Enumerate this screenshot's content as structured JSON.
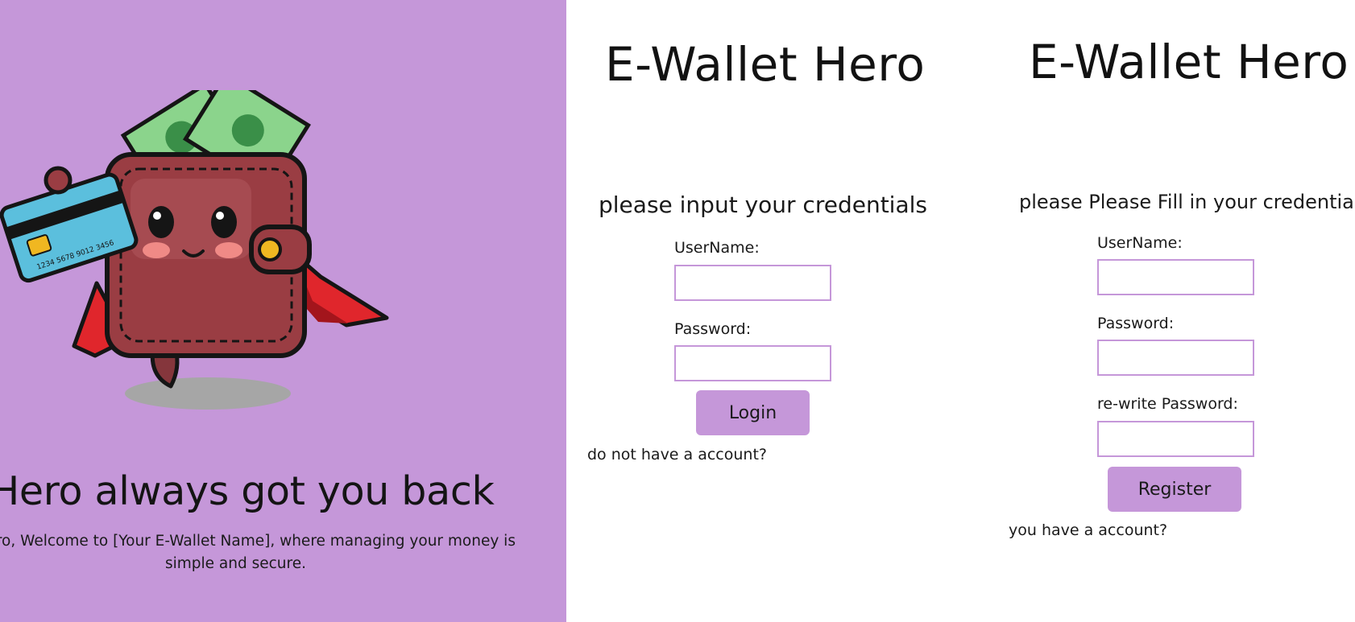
{
  "promo": {
    "headline": "let Hero always got you back",
    "text": "et Hero, Welcome to [Your E-Wallet Name], where managing your money is simple and secure."
  },
  "login": {
    "title": "E-Wallet Hero",
    "prompt": "please input your credentials",
    "username_label": "UserName:",
    "password_label": "Password:",
    "username_value": "",
    "password_value": "",
    "submit_label": "Login",
    "switch_text": "do not have a account?"
  },
  "register": {
    "title": "E-Wallet Hero",
    "prompt": "please Please Fill in your credentials",
    "username_label": "UserName:",
    "password_label": "Password:",
    "repassword_label": "re-write Password:",
    "username_value": "",
    "password_value": "",
    "repassword_value": "",
    "submit_label": "Register",
    "switch_text": "you have a account?"
  },
  "colors": {
    "accent": "#c597d9",
    "background": "#ffffff",
    "text": "#111111"
  },
  "icons": {
    "mascot": "superhero-wallet-mascot"
  }
}
